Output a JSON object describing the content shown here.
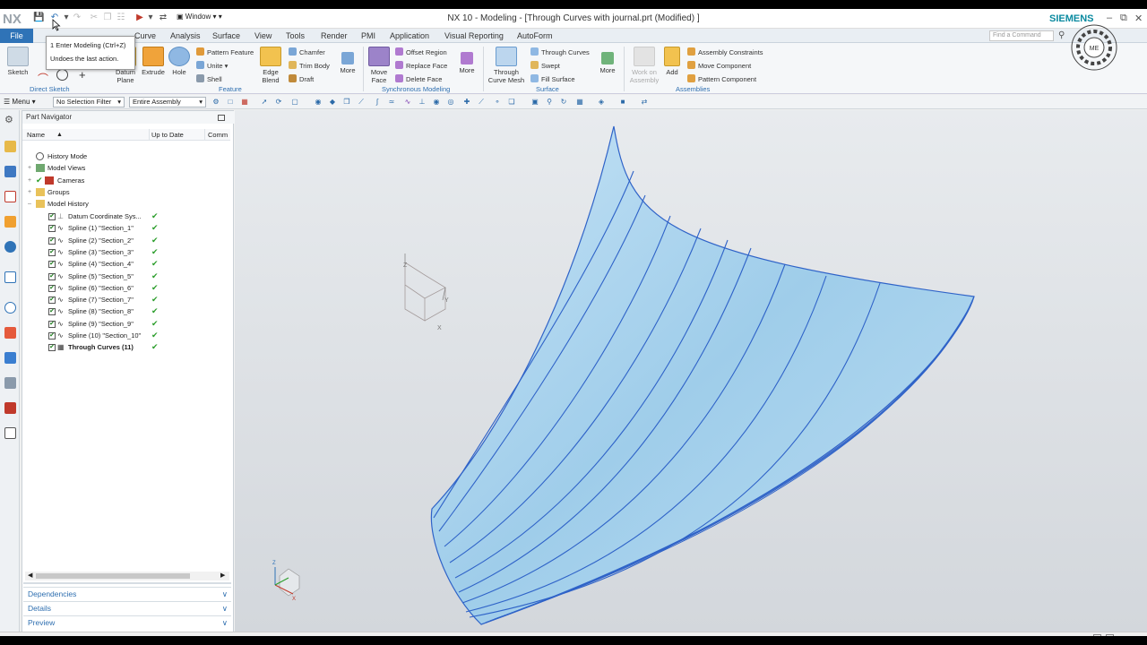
{
  "window": {
    "title": "NX 10 - Modeling - [Through Curves with journal.prt (Modified) ]",
    "brand": "SIEMENS",
    "logo": "NX",
    "window_menu": "Window"
  },
  "menu": {
    "file": "File",
    "tabs": [
      "Curve",
      "Analysis",
      "Surface",
      "View",
      "Tools",
      "Render",
      "PMI",
      "Application",
      "Visual Reporting",
      "AutoForm"
    ],
    "find_placeholder": "Find a Command"
  },
  "tooltip": {
    "title": "1 Enter Modeling (Ctrl+Z)",
    "desc": "Undoes the last action."
  },
  "ribbon": {
    "sketch": "Sketch",
    "datum_plane": "Datum Plane",
    "extrude": "Extrude",
    "hole": "Hole",
    "pattern_feature": "Pattern Feature",
    "unite": "Unite",
    "shell": "Shell",
    "edge_blend": "Edge Blend",
    "chamfer": "Chamfer",
    "trim_body": "Trim Body",
    "draft": "Draft",
    "more1": "More",
    "move_face": "Move Face",
    "offset_region": "Offset Region",
    "replace_face": "Replace Face",
    "delete_face": "Delete Face",
    "more2": "More",
    "through_curve_mesh": "Through Curve Mesh",
    "through_curves": "Through Curves",
    "swept": "Swept",
    "fill_surface": "Fill Surface",
    "more3": "More",
    "work_on_assembly": "Work on Assembly",
    "add": "Add",
    "assembly_constraints": "Assembly Constraints",
    "move_component": "Move Component",
    "pattern_component": "Pattern Component",
    "groups": {
      "direct_sketch": "Direct Sketch",
      "feature": "Feature",
      "sync": "Synchronous Modeling",
      "surface": "Surface",
      "assemblies": "Assemblies"
    }
  },
  "selbar": {
    "menu": "Menu",
    "filter": "No Selection Filter",
    "scope": "Entire Assembly"
  },
  "navigator": {
    "title": "Part Navigator",
    "columns": [
      "Name",
      "Up to Date",
      "Comm"
    ],
    "nodes": [
      {
        "label": "History Mode"
      },
      {
        "label": "Model Views"
      },
      {
        "label": "Cameras"
      },
      {
        "label": "Groups"
      },
      {
        "label": "Model History"
      }
    ],
    "features": [
      {
        "label": "Datum Coordinate Sys...",
        "bold": false
      },
      {
        "label": "Spline (1) \"Section_1\"",
        "bold": false
      },
      {
        "label": "Spline (2) \"Section_2\"",
        "bold": false
      },
      {
        "label": "Spline (3) \"Section_3\"",
        "bold": false
      },
      {
        "label": "Spline (4) \"Section_4\"",
        "bold": false
      },
      {
        "label": "Spline (5) \"Section_5\"",
        "bold": false
      },
      {
        "label": "Spline (6) \"Section_6\"",
        "bold": false
      },
      {
        "label": "Spline (7) \"Section_7\"",
        "bold": false
      },
      {
        "label": "Spline (8) \"Section_8\"",
        "bold": false
      },
      {
        "label": "Spline (9) \"Section_9\"",
        "bold": false
      },
      {
        "label": "Spline (10) \"Section_10\"",
        "bold": false
      },
      {
        "label": "Through Curves (11)",
        "bold": true
      }
    ],
    "panels": [
      "Dependencies",
      "Details",
      "Preview"
    ]
  },
  "triad": {
    "x": "X",
    "y": "Y",
    "z": "Z"
  },
  "colors": {
    "accent": "#2f73b7",
    "surface": "#a9d1ec",
    "curve": "#2f63c8"
  }
}
